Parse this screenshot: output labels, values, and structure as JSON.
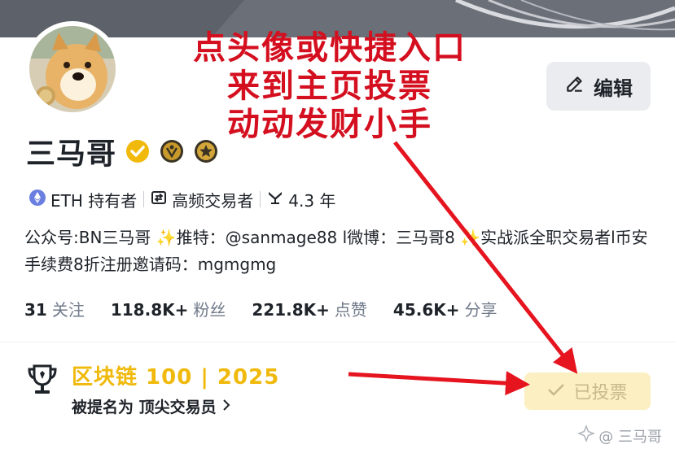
{
  "profile": {
    "name": "三马哥",
    "edit_label": "编辑",
    "tags": [
      {
        "icon": "ethereum-icon",
        "label": "ETH 持有者"
      },
      {
        "icon": "trade-swap-icon",
        "label": "高频交易者"
      },
      {
        "icon": "tenure-icon",
        "label": "4.3 年"
      }
    ],
    "bio": "公众号:BN三马哥 ✨推特：@sanmage88 l微博：三马哥8 ✨实战派全职交易者l币安手续费8折注册邀请码：mgmgmg",
    "stats": [
      {
        "num": "31",
        "label": "关注"
      },
      {
        "num": "118.8K+",
        "label": "粉丝"
      },
      {
        "num": "221.8K+",
        "label": "点赞"
      },
      {
        "num": "45.6K+",
        "label": "分享"
      }
    ]
  },
  "award": {
    "title": "区块链 100 | 2025",
    "subtitle": "被提名为 顶尖交易员",
    "vote_label": "已投票"
  },
  "annotation": {
    "lines": [
      "点头像或快捷入口",
      "来到主页投票",
      "动动发财小手"
    ]
  },
  "watermark": "@ 三马哥",
  "colors": {
    "accent": "#f0b90b",
    "annotation_red": "#d40f1f",
    "text": "#1e2329",
    "muted": "#707a8a"
  }
}
